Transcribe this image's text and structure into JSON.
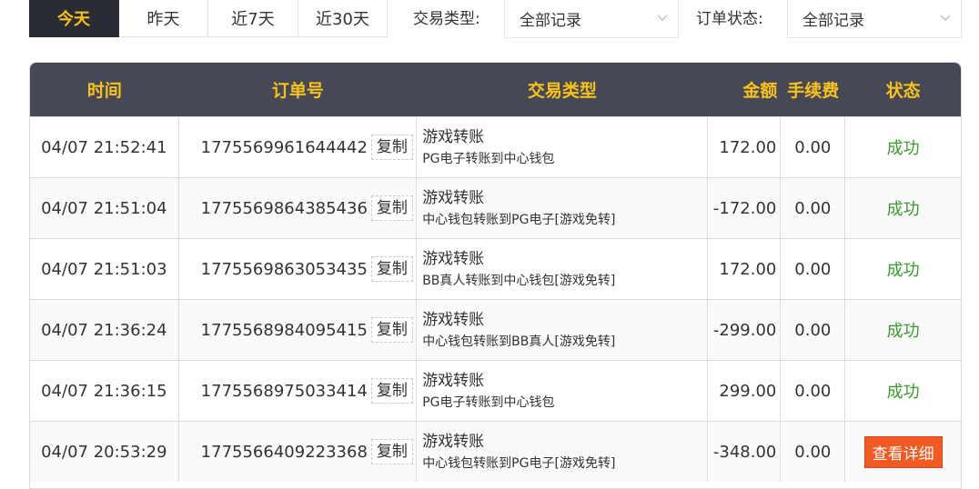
{
  "date_tabs": [
    {
      "label": "今天",
      "active": true
    },
    {
      "label": "昨天",
      "active": false
    },
    {
      "label": "近7天",
      "active": false
    },
    {
      "label": "近30天",
      "active": false
    }
  ],
  "filters": {
    "type_label": "交易类型:",
    "type_value": "全部记录",
    "status_label": "订单状态:",
    "status_value": "全部记录"
  },
  "table": {
    "headers": {
      "time": "时间",
      "order": "订单号",
      "type": "交易类型",
      "amount": "金额",
      "fee": "手续费",
      "status": "状态"
    },
    "copy_label": "复制",
    "rows": [
      {
        "time": "04/07 21:52:41",
        "order": "1775569961644442",
        "type_main": "游戏转账",
        "type_sub": "PG电子转账到中心钱包",
        "amount": "172.00",
        "fee": "0.00",
        "status": "成功",
        "status_kind": "ok"
      },
      {
        "time": "04/07 21:51:04",
        "order": "1775569864385436",
        "type_main": "游戏转账",
        "type_sub": "中心钱包转账到PG电子[游戏免转]",
        "amount": "-172.00",
        "fee": "0.00",
        "status": "成功",
        "status_kind": "ok"
      },
      {
        "time": "04/07 21:51:03",
        "order": "1775569863053435",
        "type_main": "游戏转账",
        "type_sub": "BB真人转账到中心钱包[游戏免转]",
        "amount": "172.00",
        "fee": "0.00",
        "status": "成功",
        "status_kind": "ok"
      },
      {
        "time": "04/07 21:36:24",
        "order": "1775568984095415",
        "type_main": "游戏转账",
        "type_sub": "中心钱包转账到BB真人[游戏免转]",
        "amount": "-299.00",
        "fee": "0.00",
        "status": "成功",
        "status_kind": "ok"
      },
      {
        "time": "04/07 21:36:15",
        "order": "1775568975033414",
        "type_main": "游戏转账",
        "type_sub": "PG电子转账到中心钱包",
        "amount": "299.00",
        "fee": "0.00",
        "status": "成功",
        "status_kind": "ok"
      },
      {
        "time": "04/07 20:53:29",
        "order": "1775566409223368",
        "type_main": "游戏转账",
        "type_sub": "中心钱包转账到PG电子[游戏免转]",
        "amount": "-348.00",
        "fee": "0.00",
        "status": "查看详细",
        "status_kind": "detail"
      }
    ]
  },
  "colors": {
    "header_bg": "#464856",
    "header_text": "#f7c21b",
    "active_tab_bg": "#2a2c35",
    "success": "#3a9a2c",
    "detail_button": "#f15a22"
  }
}
